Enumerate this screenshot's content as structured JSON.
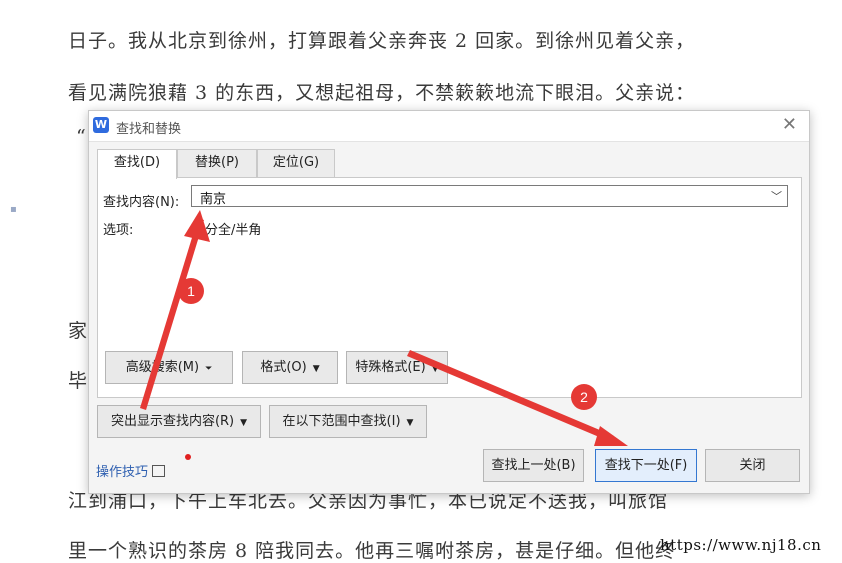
{
  "document": {
    "line1": "日子。我从北京到徐州，打算跟着父亲奔丧 2 回家。到徐州见着父亲，",
    "line2": "看见满院狼藉 3 的东西，又想起祖母，不禁簌簌地流下眼泪。父亲说：",
    "frag_quote": "“",
    "frag_jia": "家",
    "frag_bi": "毕",
    "line_bottom1": "江到浦口，下午上车北去。父亲因为事忙，本已说定不送我，叫旅馆",
    "line_bottom2": "里一个熟识的茶房 8 陪我同去。他再三嘱咐茶房，甚是仔细。但他终"
  },
  "dialog": {
    "title": "查找和替换",
    "app_icon_letter": "W",
    "close_glyph": "✕",
    "tabs": [
      {
        "label": "查找(D)",
        "active": true
      },
      {
        "label": "替换(P)",
        "active": false
      },
      {
        "label": "定位(G)",
        "active": false
      }
    ],
    "find_label": "查找内容(N):",
    "find_value": "南京",
    "options_label": "选项:",
    "options_value": "区分全/半角",
    "buttons": {
      "advanced_search": "高级搜索(M)",
      "format": "格式(O)",
      "special_format": "特殊格式(E)",
      "highlight": "突出显示查找内容(R)",
      "find_in": "在以下范围中查找(I)",
      "find_prev": "查找上一处(B)",
      "find_next": "查找下一处(F)",
      "close": "关闭"
    },
    "tips_label": "操作技巧"
  },
  "annotations": {
    "marker1": "1",
    "marker2": "2",
    "color": "#e53935"
  },
  "watermark": "https://www.nj18.cn"
}
